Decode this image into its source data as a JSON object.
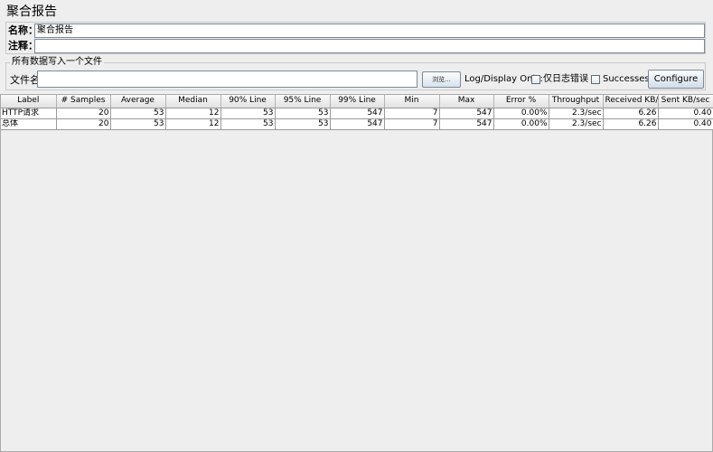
{
  "title": "聚合报告",
  "name_field": {
    "label": "名称：",
    "value": "聚合报告"
  },
  "comment_field": {
    "label": "注释：",
    "value": ""
  },
  "file_section": {
    "legend": "所有数据写入一个文件",
    "filename_label": "文件名",
    "filename_value": "",
    "browse_label": "浏览...",
    "log_display_label": "Log/Display Only:",
    "errors_only_label": "仅日志错误",
    "successes_label": "Successes",
    "configure_label": "Configure"
  },
  "table": {
    "headers": [
      "Label",
      "# Samples",
      "Average",
      "Median",
      "90% Line",
      "95% Line",
      "99% Line",
      "Min",
      "Max",
      "Error %",
      "Throughput",
      "Received KB/...",
      "Sent KB/sec"
    ],
    "rows": [
      [
        "HTTP请求",
        "20",
        "53",
        "12",
        "53",
        "53",
        "547",
        "7",
        "547",
        "0.00%",
        "2.3/sec",
        "6.26",
        "0.40"
      ],
      [
        "总体",
        "20",
        "53",
        "12",
        "53",
        "53",
        "547",
        "7",
        "547",
        "0.00%",
        "2.3/sec",
        "6.26",
        "0.40"
      ]
    ]
  }
}
